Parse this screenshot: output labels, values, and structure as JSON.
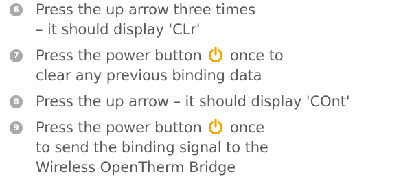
{
  "steps": [
    {
      "number": "6",
      "lines": [
        "Press the up arrow three times",
        "– it should display 'CLr'"
      ]
    },
    {
      "number": "7",
      "lines_a": [
        "Press the power button",
        "once to"
      ],
      "lines": [
        "clear any previous binding data"
      ]
    },
    {
      "number": "8",
      "lines": [
        "Press the up arrow – it should display 'COnt'"
      ]
    },
    {
      "number": "9",
      "lines_a": [
        "Press the power button",
        "once"
      ],
      "lines": [
        "to send the binding signal to the",
        "Wireless OpenTherm Bridge"
      ]
    }
  ],
  "icons": {
    "power": "power-icon",
    "power_color": "#f2a900"
  }
}
